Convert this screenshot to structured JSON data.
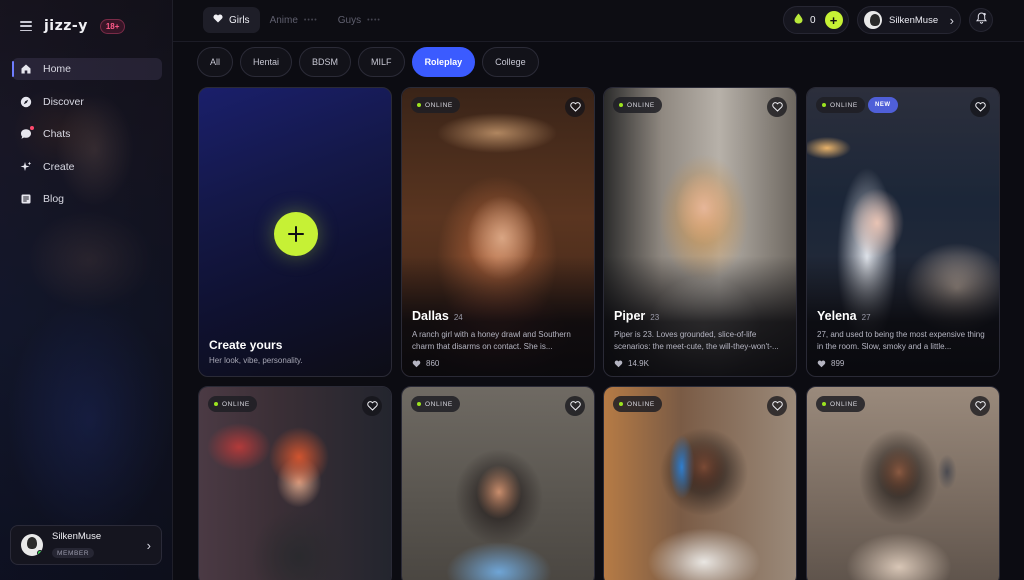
{
  "brand": {
    "logo_text": "jizz-y",
    "age_badge": "18+"
  },
  "sidebar": {
    "items": [
      {
        "label": "Home",
        "icon": "home-icon",
        "active": true
      },
      {
        "label": "Discover",
        "icon": "compass-icon"
      },
      {
        "label": "Chats",
        "icon": "chat-bubble-icon",
        "has_notification": true
      },
      {
        "label": "Create",
        "icon": "sparkle-icon"
      },
      {
        "label": "Blog",
        "icon": "newspaper-icon"
      }
    ],
    "user": {
      "name": "SilkenMuse",
      "role": "MEMBER"
    }
  },
  "topbar": {
    "tabs": [
      {
        "label": "Girls",
        "icon": "heart-icon",
        "active": true
      },
      {
        "label": "Anime",
        "extra": "••••"
      },
      {
        "label": "Guys",
        "extra": "••••"
      }
    ],
    "coins": "0",
    "username": "SilkenMuse"
  },
  "filters": [
    {
      "label": "All"
    },
    {
      "label": "Hentai"
    },
    {
      "label": "BDSM"
    },
    {
      "label": "MILF"
    },
    {
      "label": "Roleplay",
      "active": true
    },
    {
      "label": "College"
    }
  ],
  "create_card": {
    "title": "Create yours",
    "subtitle": "Her look, vibe, personality."
  },
  "cards": [
    {
      "name": "Dallas",
      "age": "24",
      "status": "ONLINE",
      "description": "A ranch girl with a honey drawl and Southern charm that disarms on contact. She is...",
      "likes": "860"
    },
    {
      "name": "Piper",
      "age": "23",
      "status": "ONLINE",
      "description": "Piper is 23. Loves grounded, slice-of-life scenarios: the meet-cute, the will-they-won't-...",
      "likes": "14.9K"
    },
    {
      "name": "Yelena",
      "age": "27",
      "status": "ONLINE",
      "badge": "NEW",
      "description": "27, and used to being the most expensive thing in the room. Slow, smoky and a little...",
      "likes": "899"
    },
    {
      "status": "ONLINE"
    },
    {
      "status": "ONLINE"
    },
    {
      "status": "ONLINE"
    },
    {
      "status": "ONLINE"
    }
  ],
  "colors": {
    "accent_blue": "#3b5bff",
    "accent_lime": "#c6f135",
    "online_green": "#9be31f",
    "background": "#0c0c12"
  }
}
